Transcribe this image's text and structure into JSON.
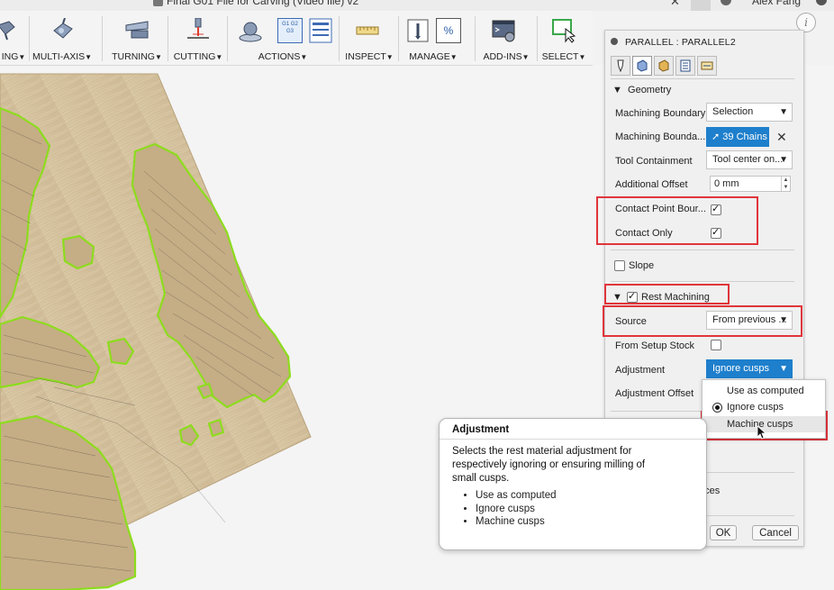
{
  "window": {
    "document_title": "Final G01 File for Carving (Video file) v2",
    "user_name": "Alex Fang"
  },
  "toolbar": {
    "groups": [
      {
        "label": "ING"
      },
      {
        "label": "MULTI-AXIS"
      },
      {
        "label": "TURNING"
      },
      {
        "label": "CUTTING"
      },
      {
        "label": "ACTIONS"
      },
      {
        "label": "INSPECT"
      },
      {
        "label": "MANAGE"
      },
      {
        "label": "ADD-INS"
      },
      {
        "label": "SELECT"
      }
    ],
    "dropdown_caret": "▼",
    "actions_icon_text": "G1 G2 G3",
    "manage_icon_text": "%"
  },
  "info_button": "i",
  "panel": {
    "title": "PARALLEL : PARALLEL2",
    "active_tab": 1,
    "geometry": {
      "header": "Geometry",
      "machining_boundary": {
        "label": "Machining Boundary",
        "value": "Selection"
      },
      "boundary_selection": {
        "label": "Machining Bounda...",
        "value": "39 Chains"
      },
      "tool_containment": {
        "label": "Tool Containment",
        "value": "Tool center on..."
      },
      "additional_offset": {
        "label": "Additional Offset",
        "value": "0 mm"
      },
      "contact_point_boundary": {
        "label": "Contact Point Bour...",
        "checked": true
      },
      "contact_only": {
        "label": "Contact Only",
        "checked": true
      }
    },
    "slope": {
      "label": "Slope",
      "checked": false
    },
    "rest_machining": {
      "header": "Rest Machining",
      "checked": true,
      "source": {
        "label": "Source",
        "value": "From previous ..."
      },
      "from_setup_stock": {
        "label": "From Setup Stock",
        "checked": false
      },
      "adjustment": {
        "label": "Adjustment",
        "value": "Ignore cusps"
      },
      "adjustment_offset": {
        "label": "Adjustment Offset"
      }
    },
    "partial_label": "aces",
    "ok_label": "OK",
    "cancel_label": "Cancel"
  },
  "adjustment_menu": {
    "options": [
      "Use as computed",
      "Ignore cusps",
      "Machine cusps"
    ],
    "selected": "Ignore cusps",
    "hovered": "Machine cusps"
  },
  "tooltip": {
    "title": "Adjustment",
    "description": "Selects the rest material adjustment for respectively ignoring or ensuring milling of small cusps.",
    "bullets": [
      "Use as computed",
      "Ignore cusps",
      "Machine cusps"
    ]
  },
  "colors": {
    "accent_blue": "#1e7fcc",
    "highlight_red": "#e0353b",
    "toolpath_green": "#8ddc1e",
    "wood": "#d8c7a6"
  }
}
